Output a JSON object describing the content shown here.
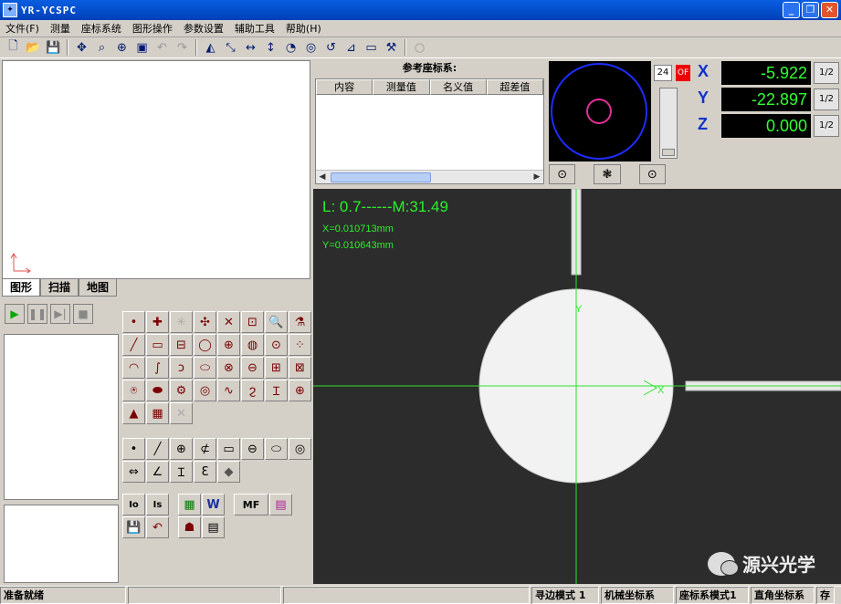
{
  "window": {
    "title": "YR-YCSPC"
  },
  "menu": [
    "文件(F)",
    "测量",
    "座标系统",
    "图形操作",
    "参数设置",
    "辅助工具",
    "帮助(H)"
  ],
  "left_tabs": [
    "图形",
    "扫描",
    "地图"
  ],
  "ref_panel": {
    "title": "参考座标系:",
    "columns": [
      "内容",
      "测量值",
      "名义值",
      "超差值"
    ]
  },
  "zoom": "24",
  "off_label": "OF",
  "dro": [
    {
      "axis": "X",
      "value": "-5.922",
      "half": "1/2"
    },
    {
      "axis": "Y",
      "value": "-22.897",
      "half": "1/2"
    },
    {
      "axis": "Z",
      "value": "0.000",
      "half": "1/2"
    }
  ],
  "camera": {
    "measure": "L: 0.7------M:31.49",
    "x_readout": "X=0.010713mm",
    "y_readout": "Y=0.010643mm",
    "y_axis_label": "Y",
    "x_axis_label": "X"
  },
  "tools": {
    "function_labels": [
      "Io",
      "Is",
      "MF"
    ]
  },
  "watermark": "源兴光学",
  "status": [
    "准备就绪",
    "寻边模式 1",
    "机械坐标系",
    "座标系模式1",
    "直角坐标系",
    "存"
  ]
}
